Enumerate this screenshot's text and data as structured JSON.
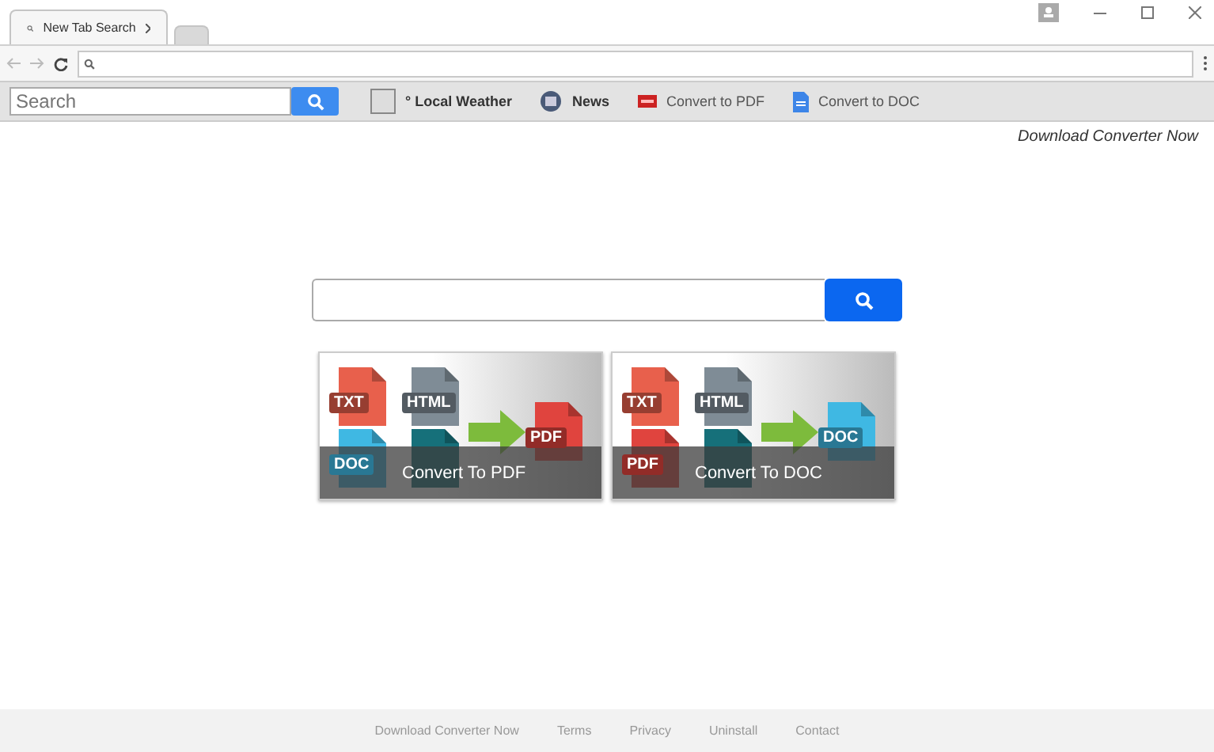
{
  "browser": {
    "tabs": [
      {
        "title": "New Tab Search",
        "selected": true
      },
      {
        "selected": false
      }
    ]
  },
  "toolbar": {
    "search": {
      "placeholder": "Search"
    },
    "items": [
      {
        "kind": "weather",
        "label": "° Local Weather"
      },
      {
        "kind": "news",
        "label": "News"
      },
      {
        "kind": "pdf",
        "label": "Convert to PDF"
      },
      {
        "kind": "doc",
        "label": "Convert to DOC"
      }
    ]
  },
  "top_link": "Download Converter Now",
  "tiles": [
    {
      "caption": "Convert To PDF",
      "sources": [
        {
          "label": "TXT",
          "color": "#e8604c"
        },
        {
          "label": "HTML",
          "color": "#7f8c96"
        },
        {
          "label": "DOC",
          "color": "#3fb8e3"
        },
        {
          "color": "#16707a"
        }
      ],
      "target": {
        "label": "PDF",
        "color": "#e0443e"
      }
    },
    {
      "caption": "Convert To DOC",
      "sources": [
        {
          "label": "TXT",
          "color": "#e8604c"
        },
        {
          "label": "HTML",
          "color": "#7f8c96"
        },
        {
          "label": "PDF",
          "color": "#e0443e"
        },
        {
          "color": "#16707a"
        }
      ],
      "target": {
        "label": "DOC",
        "color": "#3fb8e3"
      }
    }
  ],
  "footer": [
    "Download Converter Now",
    "Terms",
    "Privacy",
    "Uninstall",
    "Contact"
  ]
}
